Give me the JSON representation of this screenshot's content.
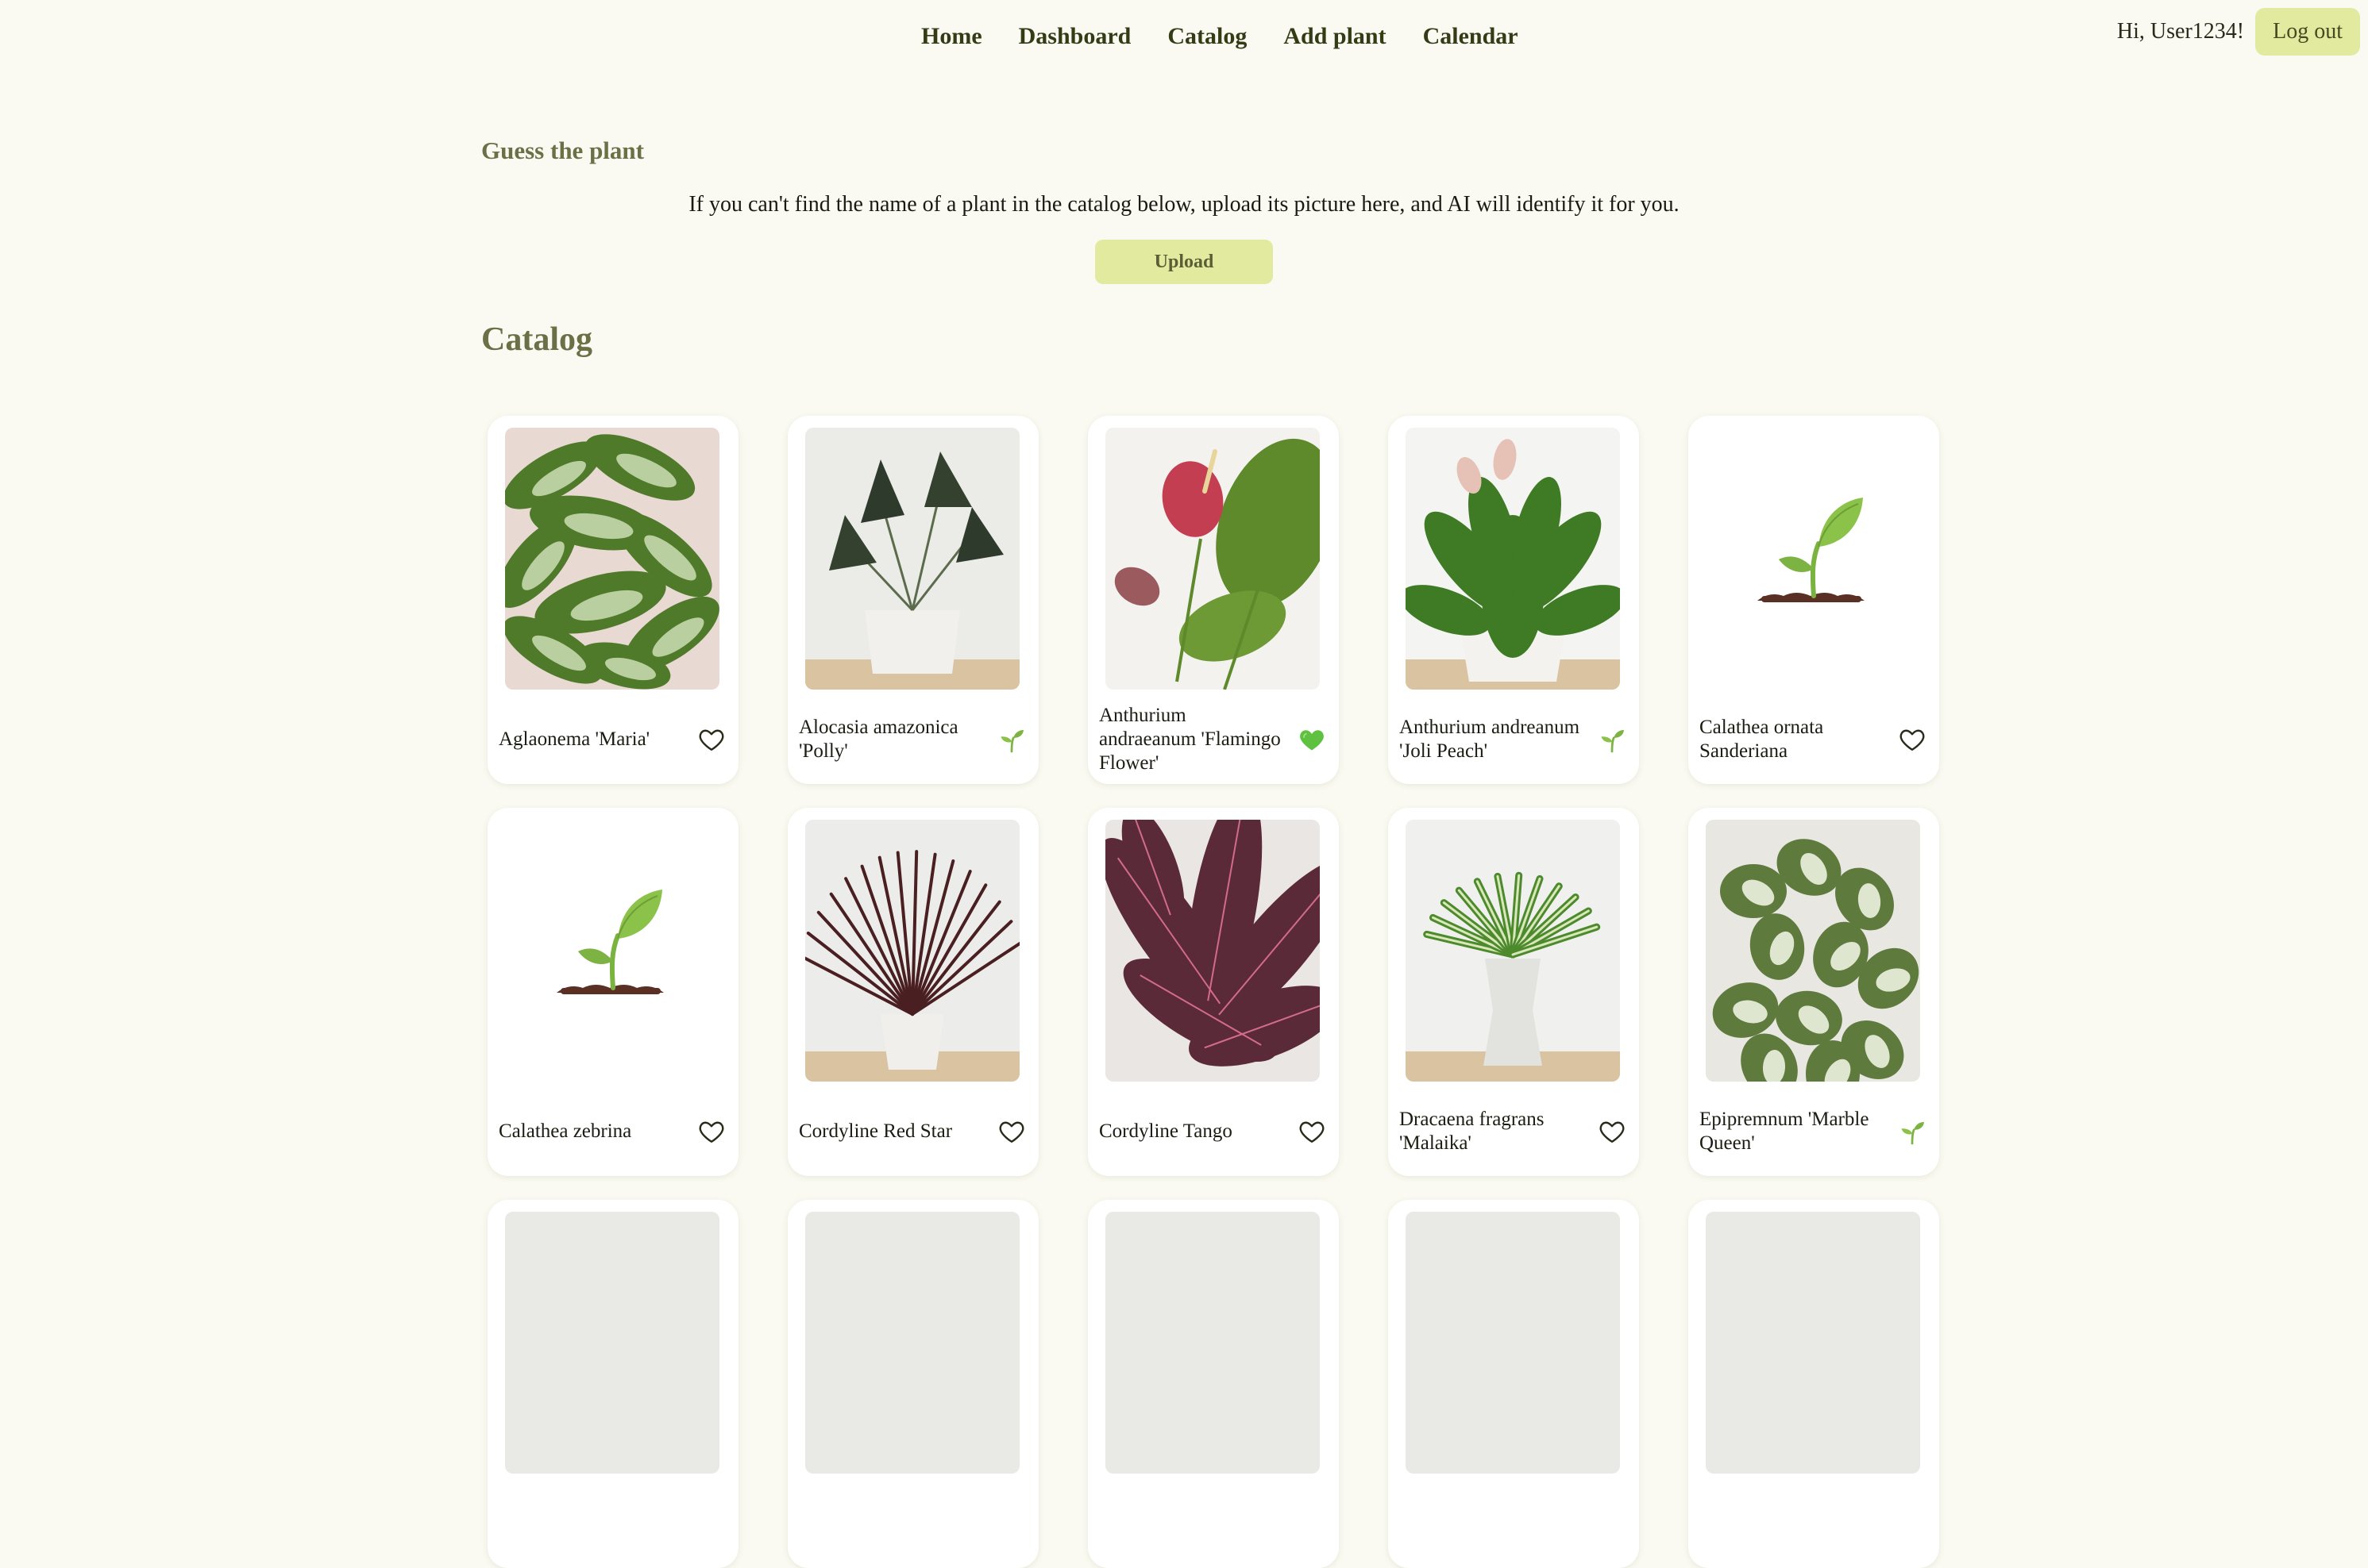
{
  "nav": {
    "links": [
      "Home",
      "Dashboard",
      "Catalog",
      "Add plant",
      "Calendar"
    ],
    "greeting": "Hi, User1234!",
    "logout_label": "Log out"
  },
  "guess": {
    "title": "Guess the plant",
    "description": "If you can't find the name of a plant in the catalog below, upload its picture here, and AI will identify it for you.",
    "upload_label": "Upload"
  },
  "catalog": {
    "title": "Catalog",
    "plants": [
      {
        "name": "Aglaonema 'Maria'",
        "status": "heart-outline",
        "image": "plant-photo-aglaonema"
      },
      {
        "name": "Alocasia amazonica 'Polly'",
        "status": "sprout",
        "image": "plant-photo-alocasia"
      },
      {
        "name": "Anthurium andraeanum 'Flamingo Flower'",
        "status": "heart-filled",
        "image": "plant-photo-anthurium-red"
      },
      {
        "name": "Anthurium andreanum 'Joli Peach'",
        "status": "sprout",
        "image": "plant-photo-anthurium-peach"
      },
      {
        "name": "Calathea ornata Sanderiana",
        "status": "heart-outline",
        "image": "placeholder-sprout"
      },
      {
        "name": "Calathea zebrina",
        "status": "heart-outline",
        "image": "placeholder-sprout"
      },
      {
        "name": "Cordyline Red Star",
        "status": "heart-outline",
        "image": "plant-photo-cordyline-red-star"
      },
      {
        "name": "Cordyline Tango",
        "status": "heart-outline",
        "image": "plant-photo-cordyline-tango"
      },
      {
        "name": "Dracaena fragrans 'Malaika'",
        "status": "heart-outline",
        "image": "plant-photo-dracaena"
      },
      {
        "name": "Epipremnum 'Marble Queen'",
        "status": "sprout",
        "image": "plant-photo-epipremnum"
      },
      {
        "name": "",
        "status": "",
        "image": "plant-photo-partial"
      },
      {
        "name": "",
        "status": "",
        "image": "plant-photo-partial"
      },
      {
        "name": "",
        "status": "",
        "image": "plant-photo-partial"
      },
      {
        "name": "",
        "status": "",
        "image": "plant-photo-partial"
      },
      {
        "name": "",
        "status": "",
        "image": "plant-photo-partial"
      }
    ]
  },
  "colors": {
    "page_bg": "#fafaf2",
    "accent": "#e1ea9f",
    "heading": "#6b7046",
    "heart_filled": "#5fc140",
    "sprout": "#7cb342"
  }
}
